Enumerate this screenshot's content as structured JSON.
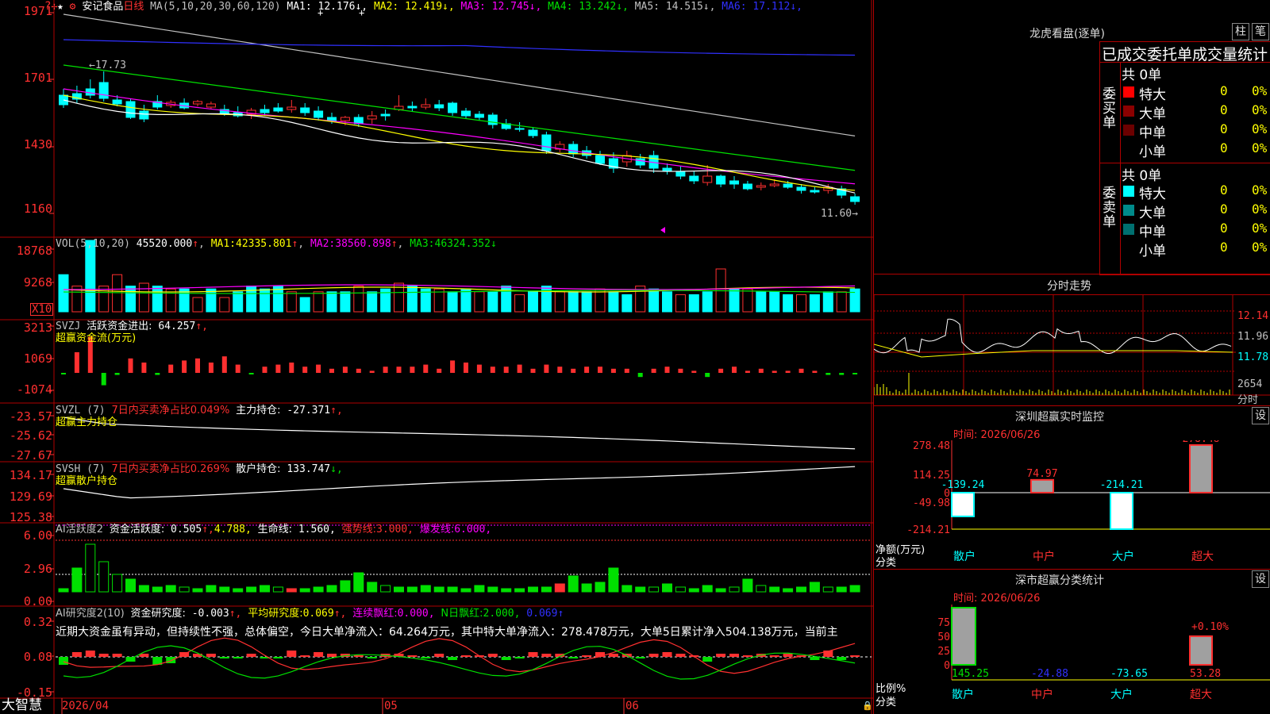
{
  "header": {
    "star": "★",
    "stock_name": "安记食品",
    "period": "日线",
    "ma_title": "MA(5,10,20,30,60,120)",
    "ma_values": [
      {
        "label": "MA1:",
        "value": "12.176",
        "arrow": "↓",
        "color": "#ffffff"
      },
      {
        "label": "MA2:",
        "value": "12.419",
        "arrow": "↓",
        "color": "#ffff00"
      },
      {
        "label": "MA3:",
        "value": "12.745",
        "arrow": "↓",
        "color": "#ff00ff"
      },
      {
        "label": "MA4:",
        "value": "13.242",
        "arrow": "↓",
        "color": "#00e000"
      },
      {
        "label": "MA5:",
        "value": "14.515",
        "arrow": "↓",
        "color": "#c0c0c0"
      },
      {
        "label": "MA6:",
        "value": "17.112",
        "arrow": "↓",
        "color": "#3030ff"
      }
    ]
  },
  "price_axis": [
    "1971",
    "1701",
    "1430",
    "1160"
  ],
  "price_labels": {
    "high": "17.73",
    "low": "11.60"
  },
  "vol_header": {
    "title": "VOL(5,10,20)",
    "value": "45520.000",
    "arrow": "↑",
    "ma1": "MA1:",
    "ma1v": "42335.801",
    "ma2": "MA2:",
    "ma2v": "38560.898",
    "ma3": "MA3:",
    "ma3v": "46324.352",
    "a1": "↑",
    "a2": "↑",
    "a3": "↓"
  },
  "vol_axis": [
    "18768",
    "9268"
  ],
  "vol_unit": "X10",
  "svzj_header": {
    "title": "SVZJ",
    "label": "活跃资金进出:",
    "value": "64.257",
    "arrow": "↑,",
    "sub": "超赢资金流(万元)"
  },
  "svzj_axis": [
    "3213",
    "1069",
    "-1074"
  ],
  "svzl_header": {
    "title": "SVZL (7)",
    "label1": "7日内买卖净占比0.049%",
    "label2": "主力持仓:",
    "value": "-27.371",
    "arrow": "↑,",
    "sub": "超赢主力持仓"
  },
  "svzl_axis": [
    "-23.57",
    "-25.62",
    "-27.67"
  ],
  "svsh_header": {
    "title": "SVSH (7)",
    "label1": "7日内买卖净占比0.269%",
    "label2": "散户持仓:",
    "value": "133.747",
    "arrow": "↓,",
    "sub": "超赢散户持仓"
  },
  "svsh_axis": [
    "134.17",
    "129.69",
    "125.38"
  ],
  "ai1_header": {
    "title": "AI活跃度2",
    "l1": "资金活跃度:",
    "v1": "0.505",
    "a1": "↑,",
    "v2": "4.788,",
    "l3": "生命线:",
    "v3": "1.560,",
    "l4": "强势线:",
    "v4": "3.000,",
    "l5": "爆发线:",
    "v5": "6.000,"
  },
  "ai1_axis": [
    "6.00",
    "2.96",
    "0.00"
  ],
  "ai2_header": {
    "title": "AI研究度2(10)",
    "l1": "资金研究度:",
    "v1": "-0.003",
    "a1": "↑,",
    "l2": "平均研究度:",
    "v2": "0.069",
    "a2": "↑,",
    "l3": "连续飘红:",
    "v3": "0.000,",
    "l4": "N日飘红:",
    "v4": "2.000,",
    "v5": "0.069",
    "a5": "↑"
  },
  "ai2_text": "近期大资金虽有异动，但持续性不强，总体偏空，今日大单净流入：64.264万元，其中特大单净流入：278.478万元，大单5日累计净入504.138万元，当前主",
  "ai2_axis": [
    "0.32",
    "0.08",
    "-0.15"
  ],
  "bottom": {
    "brand": "大智慧",
    "date_start": "2026/04",
    "m05": "05",
    "m06": "06"
  },
  "right": {
    "title": "龙虎看盘(逐单)",
    "btn1": "柱",
    "btn2": "笔",
    "tabs": "已成交委托单成交量统计",
    "buy": {
      "side": "委买单",
      "total": "共 0单",
      "rows": [
        {
          "name": "特大",
          "count": "0",
          "pct": "0%",
          "color": "#ff0000"
        },
        {
          "name": "大单",
          "count": "0",
          "pct": "0%",
          "color": "#8b0000"
        },
        {
          "name": "中单",
          "count": "0",
          "pct": "0%",
          "color": "#6b0000"
        },
        {
          "name": "小单",
          "count": "0",
          "pct": "0%",
          "color": "#000000"
        }
      ]
    },
    "sell": {
      "side": "委卖单",
      "total": "共 0单",
      "rows": [
        {
          "name": "特大",
          "count": "0",
          "pct": "0%",
          "color": "#00ffff"
        },
        {
          "name": "大单",
          "count": "0",
          "pct": "0%",
          "color": "#008b8b"
        },
        {
          "name": "中单",
          "count": "0",
          "pct": "0%",
          "color": "#007070"
        },
        {
          "name": "小单",
          "count": "0",
          "pct": "0%",
          "color": "#000000"
        }
      ]
    },
    "intraday": {
      "title": "分时走势",
      "axis": [
        "12.14",
        "11.96",
        "11.78"
      ],
      "vol": "2654",
      "vol_label": "分时"
    },
    "monitor": {
      "title": "深圳超赢实时监控",
      "btn": "设",
      "time": "时间: 2026/06/26",
      "axis": [
        "278.48",
        "114.25",
        "0",
        "-49.98",
        "-214.21"
      ],
      "ylabel": "净额(万元)",
      "xlabel": "分类",
      "cats": [
        "散户",
        "中户",
        "大户",
        "超大"
      ],
      "values": [
        "-139.24",
        "74.97",
        "-214.21",
        "278.48"
      ]
    },
    "classify": {
      "title": "深市超赢分类统计",
      "btn": "设",
      "time": "时间: 2026/06/26",
      "axis": [
        "75",
        "50",
        "25",
        "0"
      ],
      "ylabel": "比例%",
      "xlabel": "分类",
      "cats": [
        "散户",
        "中户",
        "大户",
        "超大"
      ],
      "values": [
        "145.25",
        "-24.88",
        "-73.65",
        "53.28"
      ],
      "note": "+0.10%"
    }
  },
  "colors": {
    "up": "#ff3030",
    "down": "#00ffff",
    "frame": "#b00000"
  }
}
